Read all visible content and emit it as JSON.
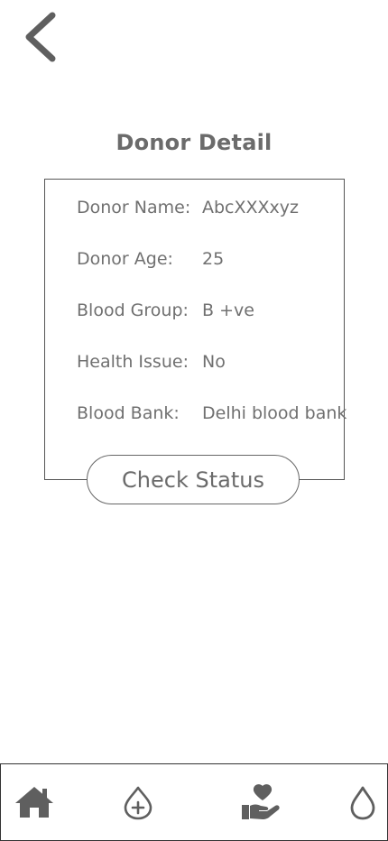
{
  "header": {
    "back_icon": "chevron-left-icon",
    "title": "Donor Detail"
  },
  "details": [
    {
      "label": "Donor Name:",
      "value": "AbcXXXxyz"
    },
    {
      "label": "Donor Age:",
      "value": "25"
    },
    {
      "label": "Blood Group:",
      "value": "B +ve"
    },
    {
      "label": "Health Issue:",
      "value": "No"
    },
    {
      "label": "Blood Bank:",
      "value": "Delhi blood bank"
    }
  ],
  "actions": {
    "check_status_label": "Check Status"
  },
  "bottom_nav": {
    "items": [
      {
        "icon": "home-icon"
      },
      {
        "icon": "add-blood-drop-icon"
      },
      {
        "icon": "heart-in-hand-icon"
      },
      {
        "icon": "blood-drop-icon"
      }
    ]
  },
  "colors": {
    "icon": "#5f5f5f",
    "text": "#6b6b6b",
    "border": "#555555"
  }
}
